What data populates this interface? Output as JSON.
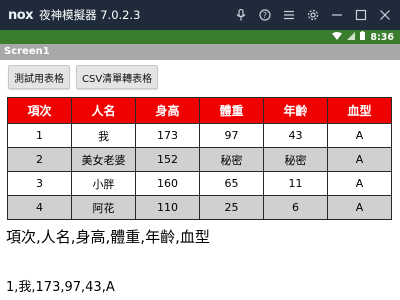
{
  "titlebar": {
    "logo": "nox",
    "title": "夜神模擬器 7.0.2.3",
    "icons": [
      "microphone-icon",
      "help-icon",
      "menu-icon",
      "settings-icon",
      "minimize-icon",
      "restore-icon",
      "close-icon"
    ]
  },
  "statusbar": {
    "time": "8:36",
    "icons": [
      "wifi-icon",
      "signal-icon",
      "battery-icon"
    ]
  },
  "screen": {
    "title": "Screen1"
  },
  "buttons": {
    "test_table": "測試用表格",
    "csv_to_table": "CSV清單轉表格"
  },
  "table": {
    "headers": [
      "項次",
      "人名",
      "身高",
      "體重",
      "年齡",
      "血型"
    ],
    "rows": [
      [
        "1",
        "我",
        "173",
        "97",
        "43",
        "A"
      ],
      [
        "2",
        "美女老婆",
        "152",
        "秘密",
        "秘密",
        "A"
      ],
      [
        "3",
        "小胖",
        "160",
        "65",
        "11",
        "A"
      ],
      [
        "4",
        "阿花",
        "110",
        "25",
        "6",
        "A"
      ]
    ]
  },
  "csv_output": {
    "header_line": "項次,人名,身高,體重,年齡,血型",
    "first_line": "1,我,173,97,43,A"
  },
  "colors": {
    "titlebar": "#1f2b3a",
    "statusbar": "#3a7d2e",
    "screenbar": "#a8a8a8",
    "table_header": "#f00000",
    "row_alt": "#d0d0d0"
  }
}
